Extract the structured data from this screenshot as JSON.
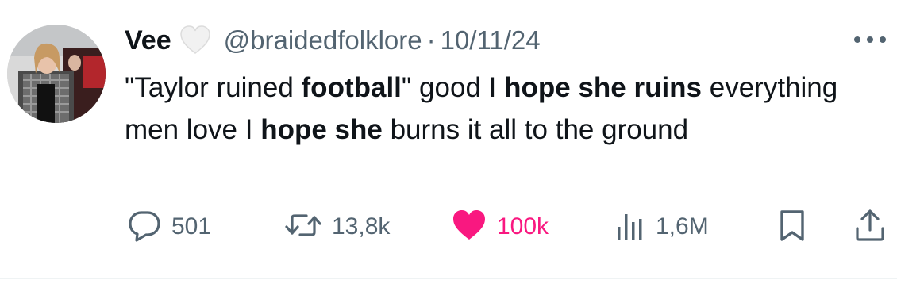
{
  "tweet": {
    "author": {
      "name": "Vee",
      "badge_icon": "white-heart-icon",
      "handle": "@braidedfolklore",
      "separator": "·",
      "date": "10/11/24"
    },
    "more_icon": "more-options-icon",
    "text_segments": [
      {
        "text": "\"Taylor ruined ",
        "bold": false
      },
      {
        "text": "football",
        "bold": true
      },
      {
        "text": "\" good I ",
        "bold": false
      },
      {
        "text": "hope she ruins",
        "bold": true
      },
      {
        "text": " everything men love I ",
        "bold": false
      },
      {
        "text": "hope she",
        "bold": true
      },
      {
        "text": " burns it all to the ground",
        "bold": false
      }
    ],
    "actions": {
      "replies": {
        "icon": "reply-icon",
        "count": "501"
      },
      "retweets": {
        "icon": "retweet-icon",
        "count": "13,8k"
      },
      "likes": {
        "icon": "heart-icon",
        "count": "100k",
        "liked": true
      },
      "views": {
        "icon": "views-icon",
        "count": "1,6M"
      },
      "bookmark": {
        "icon": "bookmark-icon"
      },
      "share": {
        "icon": "share-icon"
      }
    },
    "colors": {
      "text": "#0f1419",
      "secondary": "#536471",
      "like": "#f91880"
    }
  }
}
